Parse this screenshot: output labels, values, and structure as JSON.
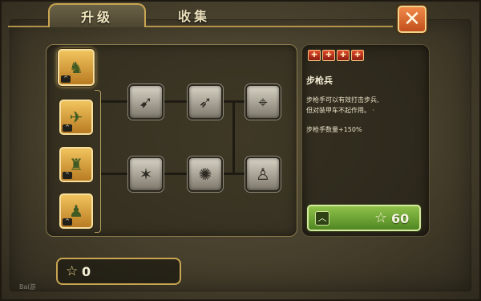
{
  "tabs": [
    {
      "label": "升级",
      "active": true
    },
    {
      "label": "收集",
      "active": false
    }
  ],
  "close_icon": "close-icon",
  "unit_cards": [
    {
      "icon": "rifleman-icon",
      "badge": "^",
      "active": true
    },
    {
      "icon": "plane-icon",
      "badge": "^"
    },
    {
      "icon": "artillery-icon",
      "badge": "^"
    },
    {
      "icon": "infantry-squad-icon",
      "badge": "^"
    }
  ],
  "skills": [
    {
      "icon": "bullet-icon",
      "row": 1
    },
    {
      "icon": "fast-bullet-icon",
      "row": 1
    },
    {
      "icon": "target-shield-icon",
      "row": 1
    },
    {
      "icon": "barbed-wire-icon",
      "row": 2
    },
    {
      "icon": "broken-wire-icon",
      "row": 2
    },
    {
      "icon": "soldier-badge-icon",
      "row": 2
    }
  ],
  "detail": {
    "cost_icons": [
      "rifle-ammo-icon",
      "rifle-ammo-icon",
      "rifle-ammo-icon",
      "rifle-ammo-icon"
    ],
    "title": "步枪兵",
    "description_lines": [
      "步枪手可以有效打击步兵,",
      "但对装甲车不起作用。 ·"
    ],
    "stat_line": "步枪手数量+150%",
    "upgrade_price": "60"
  },
  "stars": {
    "value": "0"
  },
  "watermark": "Bai游"
}
